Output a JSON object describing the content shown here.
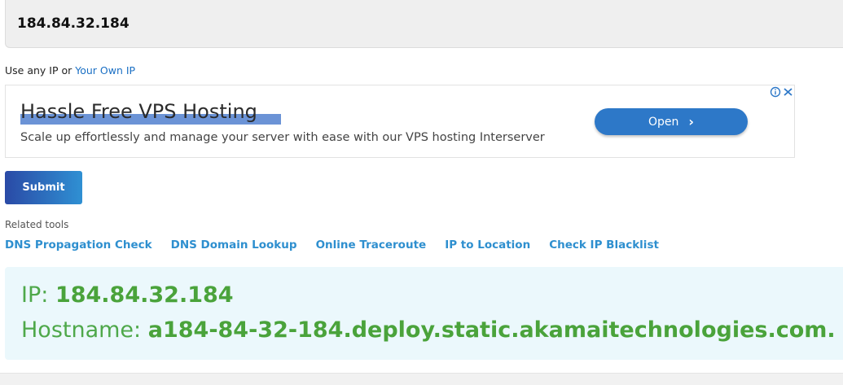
{
  "ip_input": {
    "value": "184.84.32.184"
  },
  "hint": {
    "prefix": "Use any IP or ",
    "link": "Your Own IP"
  },
  "ad": {
    "title": "Hassle Free VPS Hosting",
    "description": "Scale up effortlessly and manage your server with ease with our VPS hosting Interserver",
    "button_label": "Open",
    "button_icon": "chevron-right-icon",
    "info_icon": "info-icon",
    "close_icon": "close-icon",
    "accent_color": "#2d78c8"
  },
  "submit": {
    "label": "Submit"
  },
  "related": {
    "label": "Related tools",
    "links": [
      "DNS Propagation Check",
      "DNS Domain Lookup",
      "Online Traceroute",
      "IP to Location",
      "Check IP Blacklist"
    ]
  },
  "result": {
    "ip_label": "IP: ",
    "ip_value": "184.84.32.184",
    "hostname_label": "Hostname: ",
    "hostname_value": "a184-84-32-184.deploy.static.akamaitechnologies.com.",
    "text_color": "#4aa33b"
  }
}
